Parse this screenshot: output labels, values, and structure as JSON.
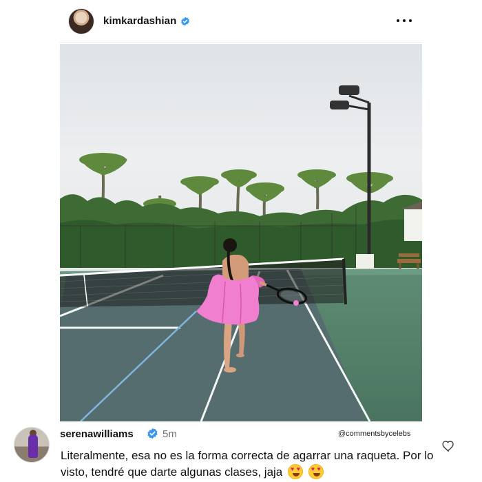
{
  "post": {
    "username": "kimkardashian",
    "more_icon": "more-horizontal-icon",
    "verified_icon": "verified-badge-icon"
  },
  "photo": {
    "subject": "tennis-court-photo"
  },
  "comment": {
    "username": "serenawilliams",
    "time": "5m",
    "credit": "@commentsbycelebs",
    "text": "Literalmente, esa no es la forma correcta de agarrar una raqueta. Por lo visto, tendré que darte algunas clases, jaja",
    "emojis": [
      "heart-eyes-emoji",
      "heart-eyes-emoji"
    ],
    "like_icon": "heart-outline-icon"
  },
  "colors": {
    "verified_blue": "#3897f0",
    "muted_text": "#737373",
    "court_green": "#4f7a63",
    "court_inner": "#566d70",
    "robe_pink": "#f07fcf"
  }
}
